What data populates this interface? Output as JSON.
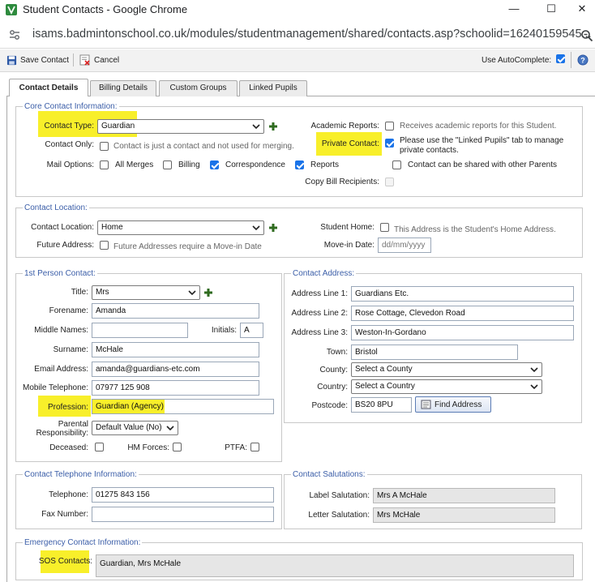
{
  "window": {
    "title": "Student Contacts - Google Chrome",
    "url": "isams.badmintonschool.co.uk/modules/studentmanagement/shared/contacts.asp?schoolid=16240159545..."
  },
  "toolbar": {
    "save_label": "Save Contact",
    "cancel_label": "Cancel",
    "autocomplete_label": "Use AutoComplete:",
    "autocomplete_checked": true
  },
  "tabs": [
    "Contact Details",
    "Billing Details",
    "Custom Groups",
    "Linked Pupils"
  ],
  "core": {
    "legend": "Core Contact Information:",
    "contact_type_label": "Contact Type:",
    "contact_type_value": "Guardian",
    "contact_only_label": "Contact Only:",
    "contact_only_note": "Contact is just a contact and not used for merging.",
    "mail_options_label": "Mail Options:",
    "mail_all_merges": "All Merges",
    "mail_billing": "Billing",
    "mail_correspondence": "Correspondence",
    "mail_reports": "Reports",
    "academic_reports_label": "Academic Reports:",
    "academic_reports_note": "Receives academic reports for this Student.",
    "private_contact_label": "Private Contact:",
    "private_contact_note_1": "Please use the \"Linked Pupils\" tab to manage",
    "private_contact_note_2": "private contacts.",
    "shared_note": "Contact can be shared with other Parents",
    "copy_bill_label": "Copy Bill Recipients:"
  },
  "location": {
    "legend": "Contact Location:",
    "contact_location_label": "Contact Location:",
    "contact_location_value": "Home",
    "future_address_label": "Future Address:",
    "future_address_note": "Future Addresses require a Move-in Date",
    "student_home_label": "Student Home:",
    "student_home_note": "This Address is the Student's Home Address.",
    "move_in_label": "Move-in Date:",
    "move_in_placeholder": "dd/mm/yyyy"
  },
  "person": {
    "legend": "1st Person Contact:",
    "title_label": "Title:",
    "title_value": "Mrs",
    "forename_label": "Forename:",
    "forename_value": "Amanda",
    "middle_label": "Middle Names:",
    "middle_value": "",
    "initials_label": "Initials:",
    "initials_value": "A",
    "surname_label": "Surname:",
    "surname_value": "McHale",
    "email_label": "Email Address:",
    "email_value": "amanda@guardians-etc.com",
    "mobile_label": "Mobile Telephone:",
    "mobile_value": "07977 125 908",
    "profession_label": "Profession:",
    "profession_value": "Guardian (Agency)",
    "parental_label_1": "Parental",
    "parental_label_2": "Responsibility:",
    "parental_value": "Default Value (No)",
    "deceased_label": "Deceased:",
    "hm_forces_label": "HM Forces:",
    "ptfa_label": "PTFA:"
  },
  "address": {
    "legend": "Contact Address:",
    "line1_label": "Address Line 1:",
    "line1_value": "Guardians Etc.",
    "line2_label": "Address Line 2:",
    "line2_value": "Rose Cottage, Clevedon Road",
    "line3_label": "Address Line 3:",
    "line3_value": "Weston-In-Gordano",
    "town_label": "Town:",
    "town_value": "Bristol",
    "county_label": "County:",
    "county_value": "Select a County",
    "country_label": "Country:",
    "country_value": "Select a Country",
    "postcode_label": "Postcode:",
    "postcode_value": "BS20 8PU",
    "find_address_label": "Find Address"
  },
  "telephone": {
    "legend": "Contact Telephone Information:",
    "telephone_label": "Telephone:",
    "telephone_value": "01275 843 156",
    "fax_label": "Fax Number:",
    "fax_value": ""
  },
  "salutations": {
    "legend": "Contact Salutations:",
    "label_sal_label": "Label Salutation:",
    "label_sal_value": "Mrs A McHale",
    "letter_sal_label": "Letter Salutation:",
    "letter_sal_value": "Mrs McHale"
  },
  "emergency": {
    "legend": "Emergency Contact Information:",
    "sos_label": "SOS Contacts:",
    "sos_value": "Guardian, Mrs McHale"
  },
  "colors": {
    "highlight": "#f8ef2a",
    "legend_text": "#3b5ea8",
    "checkbox_checked": "#1a73e8"
  }
}
